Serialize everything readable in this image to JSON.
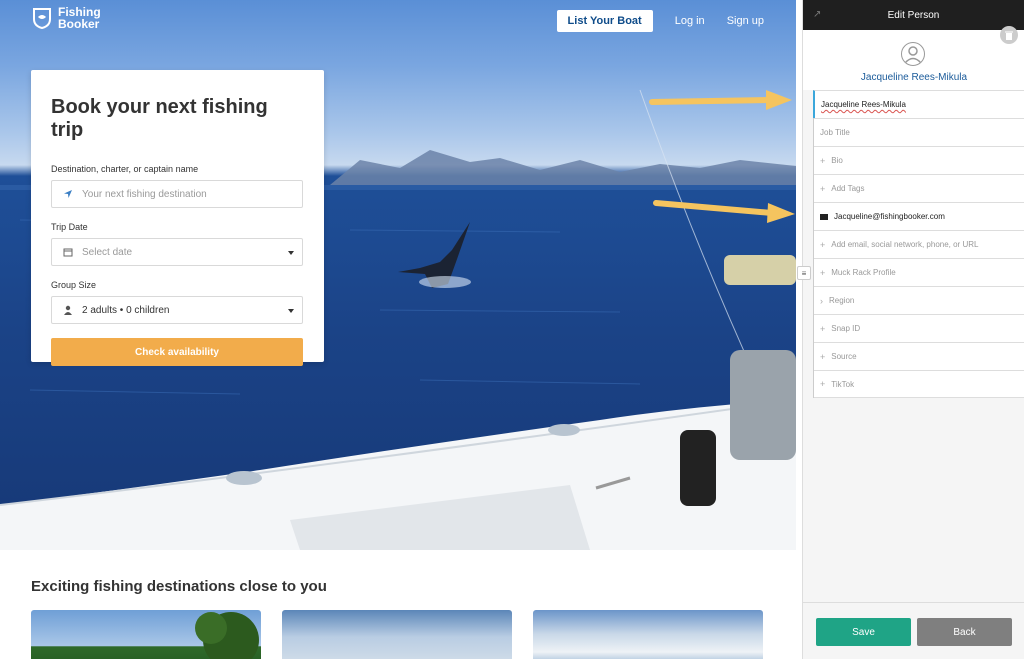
{
  "site": {
    "logo_line1": "Fishing",
    "logo_line2": "Booker",
    "nav": {
      "list_boat": "List Your Boat",
      "login": "Log in",
      "signup": "Sign up"
    },
    "booking": {
      "title": "Book your next fishing trip",
      "destination_label": "Destination, charter, or captain name",
      "destination_placeholder": "Your next fishing destination",
      "date_label": "Trip Date",
      "date_placeholder": "Select date",
      "group_label": "Group Size",
      "group_value": "2 adults • 0 children",
      "check_button": "Check availability"
    },
    "destinations_heading": "Exciting fishing destinations close to you"
  },
  "panel": {
    "title": "Edit Person",
    "person_name": "Jacqueline Rees-Mikula",
    "fields": {
      "name": "Jacqueline Rees-Mikula",
      "job_title": "Job Title",
      "bio": "Bio",
      "tags": "Add Tags",
      "email": "Jacqueline@fishingbooker.com",
      "add_contact": "Add email, social network, phone, or URL",
      "muck_rack": "Muck Rack Profile",
      "region": "Region",
      "snap_id": "Snap ID",
      "source": "Source",
      "tiktok": "TikTok"
    },
    "save": "Save",
    "back": "Back"
  },
  "colors": {
    "accent_orange": "#f2ac4b",
    "save_green": "#1fa486",
    "back_gray": "#7f7f7f",
    "link_blue": "#1b5b9a"
  }
}
